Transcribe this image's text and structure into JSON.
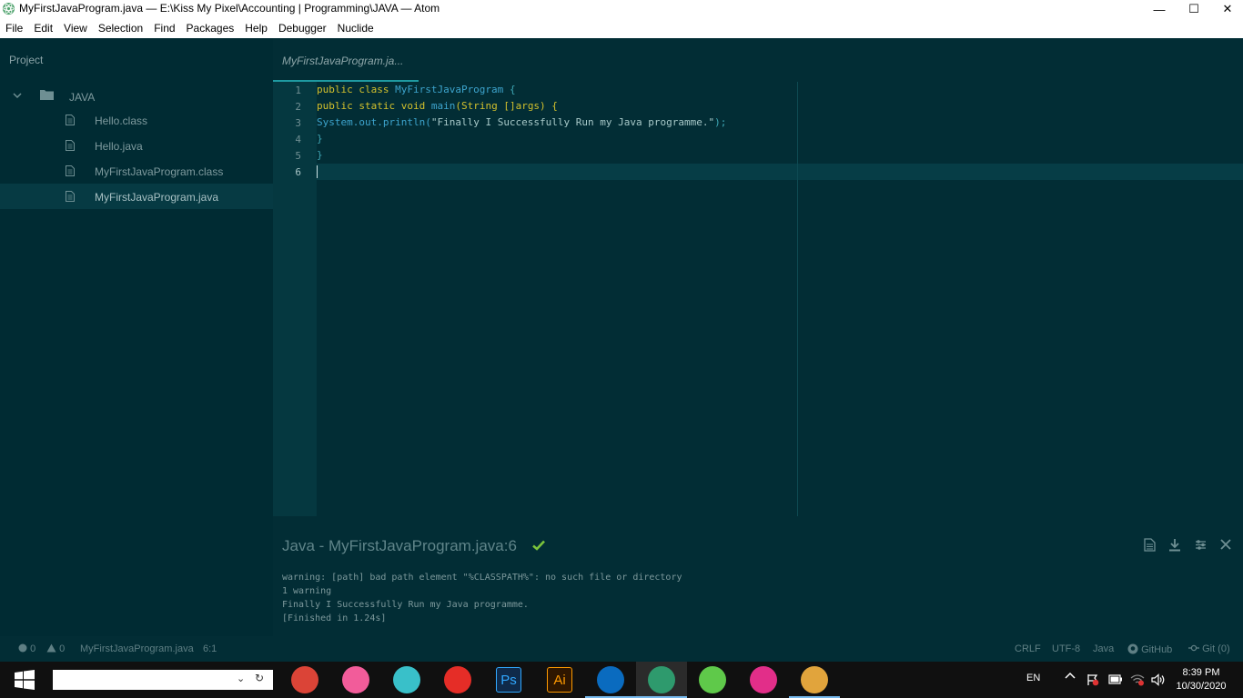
{
  "window": {
    "title": "MyFirstJavaProgram.java — E:\\Kiss My Pixel\\Accounting |  Programming\\JAVA — Atom",
    "minimize": "—",
    "maximize": "☐",
    "close": "✕"
  },
  "menu": [
    "File",
    "Edit",
    "View",
    "Selection",
    "Find",
    "Packages",
    "Help",
    "Debugger",
    "Nuclide"
  ],
  "project": {
    "header": "Project",
    "root": "JAVA",
    "files": [
      {
        "name": "Hello.class"
      },
      {
        "name": "Hello.java"
      },
      {
        "name": "MyFirstJavaProgram.class"
      },
      {
        "name": "MyFirstJavaProgram.java",
        "selected": true
      }
    ]
  },
  "tab": {
    "label": "MyFirstJavaProgram.ja..."
  },
  "editor": {
    "line_numbers": [
      "1",
      "2",
      "3",
      "4",
      "5",
      "6"
    ],
    "lines": [
      [
        {
          "t": "public class ",
          "c": "kw"
        },
        {
          "t": "MyFirstJavaProgram ",
          "c": "cls"
        },
        {
          "t": "{",
          "c": "punc"
        }
      ],
      [
        {
          "t": "public static void ",
          "c": "kw"
        },
        {
          "t": "main",
          "c": "cls"
        },
        {
          "t": "(String []args) {",
          "c": "kw"
        }
      ],
      [
        {
          "t": "System.out.println(",
          "c": "plain"
        },
        {
          "t": "\"Finally I Successfully Run my Java programme.\"",
          "c": "str"
        },
        {
          "t": ");",
          "c": "punc"
        }
      ],
      [
        {
          "t": "}",
          "c": "punc"
        }
      ],
      [
        {
          "t": "}",
          "c": "punc"
        }
      ],
      []
    ],
    "cursor_line": 6
  },
  "output": {
    "title": "Java - MyFirstJavaProgram.java:6",
    "lines": [
      "warning: [path] bad path element \"%CLASSPATH%\": no such file or directory",
      "1 warning",
      "Finally I Successfully Run my Java programme.",
      "[Finished in 1.24s]"
    ]
  },
  "status": {
    "errors": "0",
    "warnings": "0",
    "file": "MyFirstJavaProgram.java",
    "position": "6:1",
    "line_ending": "CRLF",
    "encoding": "UTF-8",
    "grammar": "Java",
    "github": "GitHub",
    "git": "Git (0)"
  },
  "taskbar": {
    "language": "EN",
    "time": "8:39 PM",
    "date": "10/30/2020",
    "apps": [
      {
        "name": "chrome",
        "color": "#db4437"
      },
      {
        "name": "itunes",
        "color": "#f25c9a"
      },
      {
        "name": "video-editor",
        "color": "#39c0c9"
      },
      {
        "name": "youtube-music",
        "color": "#e52d27"
      },
      {
        "name": "photoshop",
        "color": "#0f2a4a",
        "text": "Ps"
      },
      {
        "name": "illustrator",
        "color": "#2e1600",
        "text": "Ai"
      },
      {
        "name": "vscode",
        "color": "#0a6bbf"
      },
      {
        "name": "atom",
        "color": "#2e9a6d",
        "active": true
      },
      {
        "name": "messages",
        "color": "#5fc94a"
      },
      {
        "name": "installer",
        "color": "#e22e89"
      },
      {
        "name": "paint",
        "color": "#e1a43c"
      }
    ]
  },
  "colors": {
    "accent": "#1f9aa1",
    "check": "#7cc43b"
  }
}
